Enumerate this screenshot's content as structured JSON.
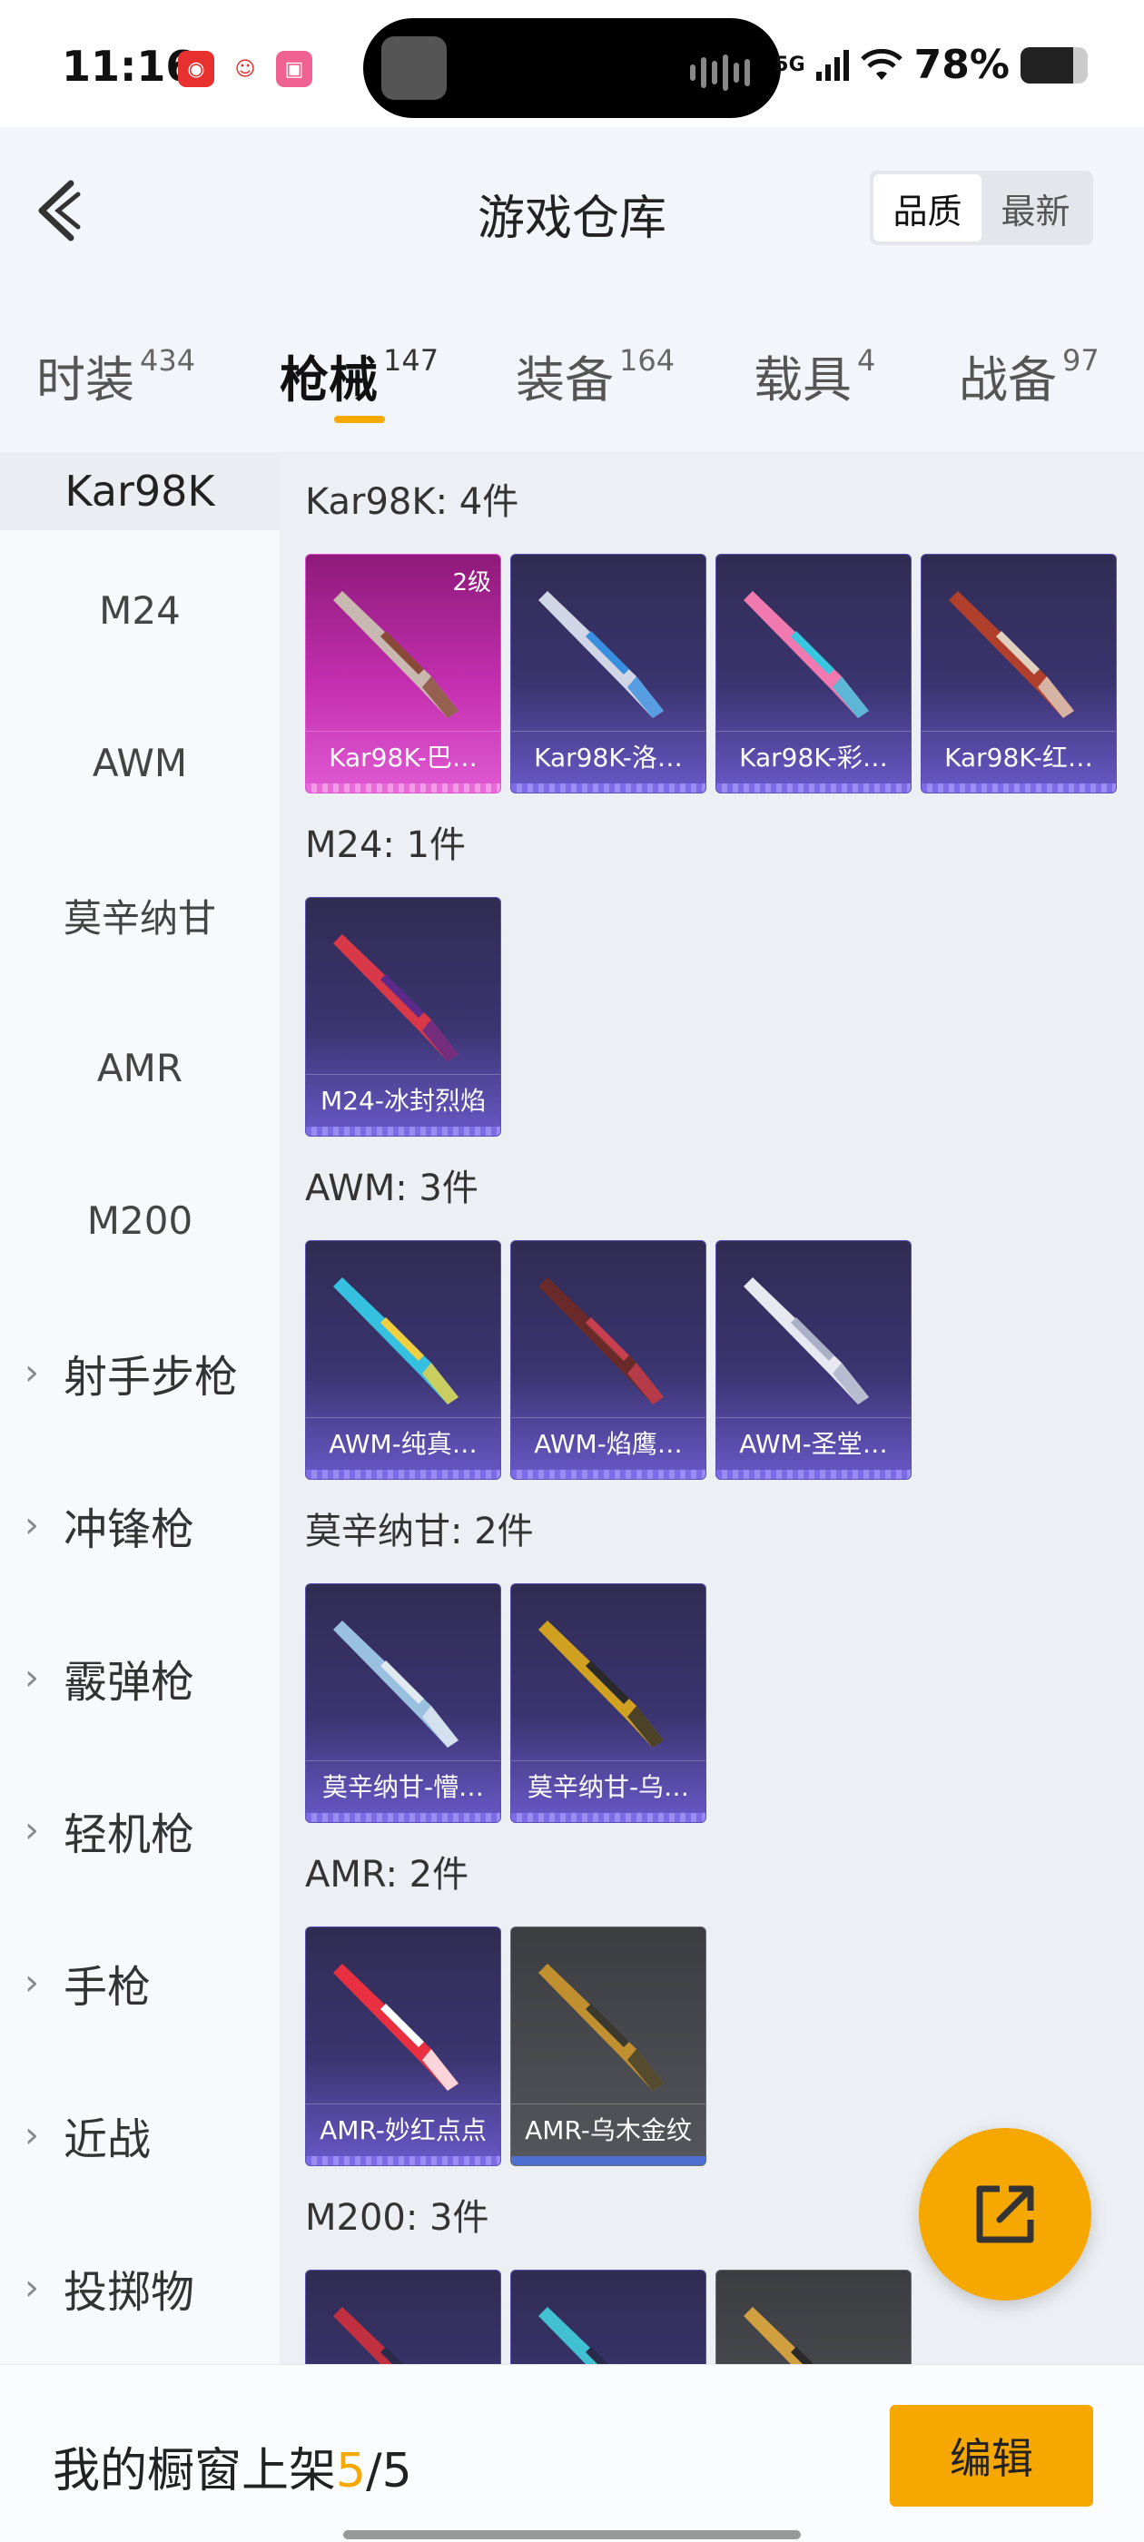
{
  "status_bar": {
    "time": "11:16",
    "network": "5G",
    "battery_text": "78%",
    "battery_level": 0.78,
    "app_icons": [
      "netease-music-icon",
      "app-icon",
      "bilibili-icon"
    ]
  },
  "header": {
    "title": "游戏仓库",
    "back_icon": "chevron-left-icon",
    "sort_options": [
      "品质",
      "最新"
    ],
    "sort_active": "品质"
  },
  "tabs": [
    {
      "label": "时装",
      "count": "434"
    },
    {
      "label": "枪械",
      "count": "147",
      "active": true
    },
    {
      "label": "装备",
      "count": "164"
    },
    {
      "label": "载具",
      "count": "4"
    },
    {
      "label": "战备",
      "count": "97"
    }
  ],
  "sidebar": {
    "current": "Kar98K",
    "sub_items": [
      "M24",
      "AWM",
      "莫辛纳甘",
      "AMR",
      "M200"
    ],
    "groups": [
      "射手步枪",
      "冲锋枪",
      "霰弹枪",
      "轻机枪",
      "手枪",
      "近战",
      "投掷物"
    ]
  },
  "sections": [
    {
      "title": "Kar98K: 4件",
      "items": [
        {
          "label": "Kar98K-巴…",
          "level": "2级",
          "style": "pink"
        },
        {
          "label": "Kar98K-洛…"
        },
        {
          "label": "Kar98K-彩…"
        },
        {
          "label": "Kar98K-红…"
        }
      ]
    },
    {
      "title": "M24: 1件",
      "items": [
        {
          "label": "M24-冰封烈焰"
        }
      ]
    },
    {
      "title": "AWM: 3件",
      "items": [
        {
          "label": "AWM-纯真…"
        },
        {
          "label": "AWM-焰鹰…"
        },
        {
          "label": "AWM-圣堂…"
        }
      ]
    },
    {
      "title": "莫辛纳甘: 2件",
      "items": [
        {
          "label": "莫辛纳甘-懵…"
        },
        {
          "label": "莫辛纳甘-乌…"
        }
      ]
    },
    {
      "title": "AMR: 2件",
      "items": [
        {
          "label": "AMR-妙红点点"
        },
        {
          "label": "AMR-乌木金纹",
          "style": "gray"
        }
      ]
    },
    {
      "title": "M200: 3件",
      "items": [
        {
          "label": ""
        },
        {
          "label": ""
        },
        {
          "label": "",
          "style": "gray"
        }
      ]
    }
  ],
  "bottom_bar": {
    "showcase_prefix": "我的橱窗上架",
    "showcase_current": "5",
    "showcase_sep": "/",
    "showcase_total": "5",
    "edit_label": "编辑"
  },
  "fab_icon": "share-external-icon",
  "colors": {
    "accent": "#f7a800",
    "card_purple": "#3a3470",
    "card_pink": "#c42fb0"
  }
}
